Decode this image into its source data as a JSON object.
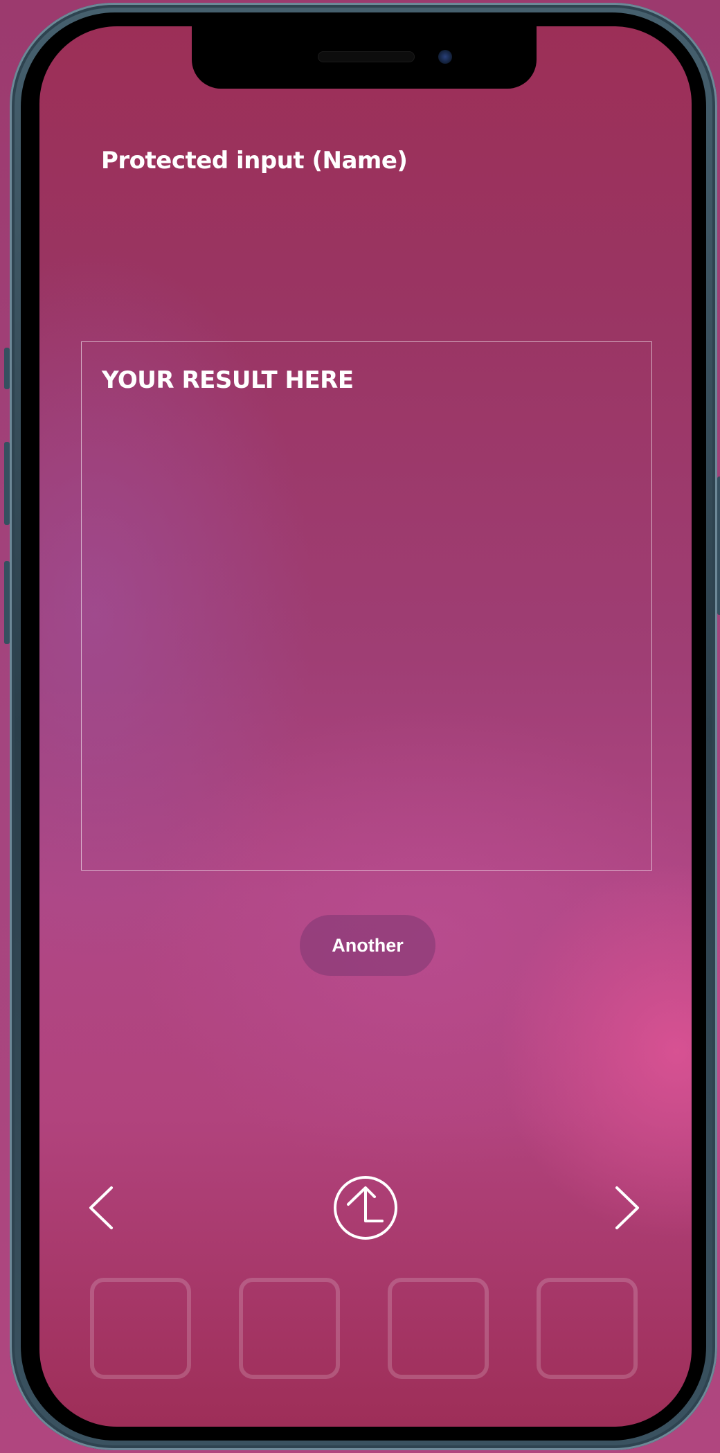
{
  "screen": {
    "title": "Protected input (Name)",
    "result_placeholder": "YOUR RESULT HERE",
    "another_button_label": "Another"
  },
  "navigation": {
    "prev_icon": "chevron-left-icon",
    "upload_icon": "arrow-up-circle-icon",
    "next_icon": "chevron-right-icon"
  },
  "slots_count": 4,
  "colors": {
    "text": "#ffffff",
    "button_bg": "#8c3c78",
    "frame": "#2b3f4b"
  }
}
